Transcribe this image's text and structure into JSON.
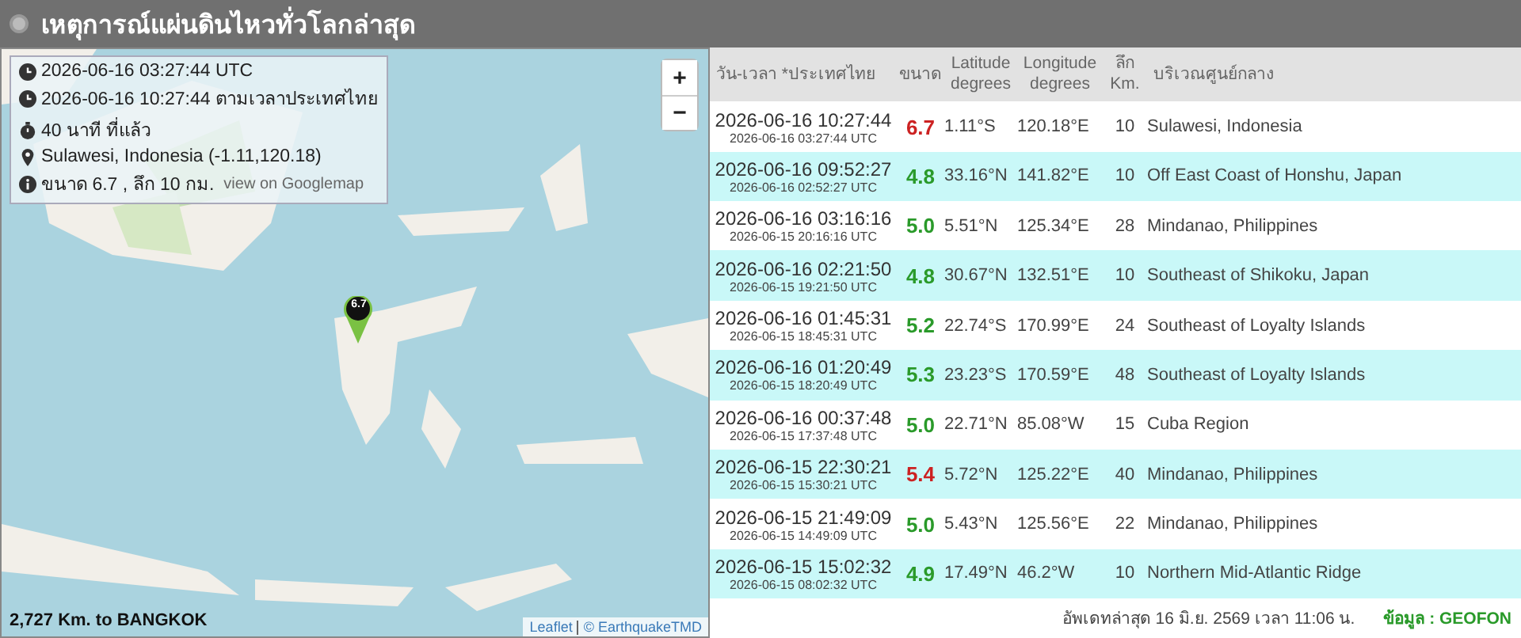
{
  "header": {
    "title": "เหตุการณ์แผ่นดินไหวทั่วโลกล่าสุด"
  },
  "map": {
    "zoom_in": "+",
    "zoom_out": "−",
    "marker": "6.7",
    "info": {
      "utc": "2026-06-16 03:27:44 UTC",
      "local": "2026-06-16 10:27:44 ตามเวลาประเทศไทย",
      "ago": "40 นาที ที่แล้ว",
      "place": "Sulawesi, Indonesia (-1.11,120.18)",
      "detail": "ขนาด 6.7 , ลึก 10 กม.",
      "link": "view on Googlemap"
    },
    "distance": "2,727 Km. to BANGKOK",
    "attribution": [
      "Leaflet",
      "© EarthquakeTMD"
    ]
  },
  "table": {
    "columns": [
      [
        "วัน-เวลา *ประเทศไทย"
      ],
      [
        "ขนาด"
      ],
      [
        "Latitude",
        "degrees"
      ],
      [
        "Longitude",
        "degrees"
      ],
      [
        "ลึก",
        "Km."
      ],
      [
        "บริเวณศูนย์กลาง"
      ]
    ],
    "rows": [
      {
        "local": "2026-06-16 10:27:44",
        "utc": "2026-06-16 03:27:44 UTC",
        "mag": "6.7",
        "color": "#cc2222",
        "lat": "1.11°S",
        "lon": "120.18°E",
        "depth": "10",
        "region": "Sulawesi, Indonesia"
      },
      {
        "local": "2026-06-16 09:52:27",
        "utc": "2026-06-16 02:52:27 UTC",
        "mag": "4.8",
        "color": "#2a9a2a",
        "lat": "33.16°N",
        "lon": "141.82°E",
        "depth": "10",
        "region": "Off East Coast of Honshu, Japan"
      },
      {
        "local": "2026-06-16 03:16:16",
        "utc": "2026-06-15 20:16:16 UTC",
        "mag": "5.0",
        "color": "#2a9a2a",
        "lat": "5.51°N",
        "lon": "125.34°E",
        "depth": "28",
        "region": "Mindanao, Philippines"
      },
      {
        "local": "2026-06-16 02:21:50",
        "utc": "2026-06-15 19:21:50 UTC",
        "mag": "4.8",
        "color": "#2a9a2a",
        "lat": "30.67°N",
        "lon": "132.51°E",
        "depth": "10",
        "region": "Southeast of Shikoku, Japan"
      },
      {
        "local": "2026-06-16 01:45:31",
        "utc": "2026-06-15 18:45:31 UTC",
        "mag": "5.2",
        "color": "#2a9a2a",
        "lat": "22.74°S",
        "lon": "170.99°E",
        "depth": "24",
        "region": "Southeast of Loyalty Islands"
      },
      {
        "local": "2026-06-16 01:20:49",
        "utc": "2026-06-15 18:20:49 UTC",
        "mag": "5.3",
        "color": "#2a9a2a",
        "lat": "23.23°S",
        "lon": "170.59°E",
        "depth": "48",
        "region": "Southeast of Loyalty Islands"
      },
      {
        "local": "2026-06-16 00:37:48",
        "utc": "2026-06-15 17:37:48 UTC",
        "mag": "5.0",
        "color": "#2a9a2a",
        "lat": "22.71°N",
        "lon": "85.08°W",
        "depth": "15",
        "region": "Cuba Region"
      },
      {
        "local": "2026-06-15 22:30:21",
        "utc": "2026-06-15 15:30:21 UTC",
        "mag": "5.4",
        "color": "#cc2222",
        "lat": "5.72°N",
        "lon": "125.22°E",
        "depth": "40",
        "region": "Mindanao, Philippines"
      },
      {
        "local": "2026-06-15 21:49:09",
        "utc": "2026-06-15 14:49:09 UTC",
        "mag": "5.0",
        "color": "#2a9a2a",
        "lat": "5.43°N",
        "lon": "125.56°E",
        "depth": "22",
        "region": "Mindanao, Philippines"
      },
      {
        "local": "2026-06-15 15:02:32",
        "utc": "2026-06-15 08:02:32 UTC",
        "mag": "4.9",
        "color": "#2a9a2a",
        "lat": "17.49°N",
        "lon": "46.2°W",
        "depth": "10",
        "region": "Northern Mid-Atlantic Ridge"
      }
    ],
    "updated": "อัพเดทล่าสุด 16 มิ.ย. 2569 เวลา 11:06 น.",
    "source": "ข้อมูล : GEOFON"
  }
}
